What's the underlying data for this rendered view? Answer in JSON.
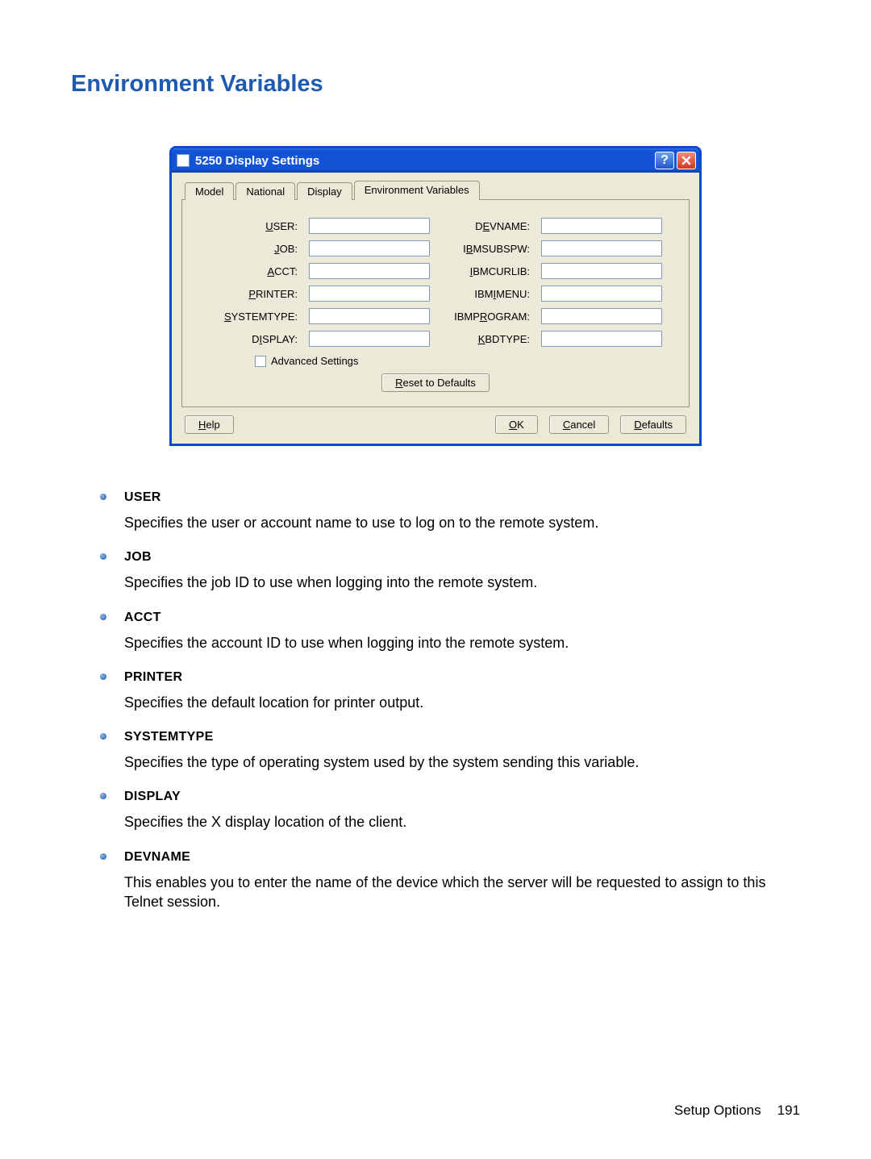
{
  "heading": "Environment Variables",
  "dialog": {
    "title": "5250 Display Settings",
    "tabs": [
      "Model",
      "National",
      "Display",
      "Environment Variables"
    ],
    "activeTab": 3,
    "fieldsLeft": [
      "USER:",
      "JOB:",
      "ACCT:",
      "PRINTER:",
      "SYSTEMTYPE:",
      "DISPLAY:"
    ],
    "fieldsRight": [
      "DEVNAME:",
      "IBMSUBSPW:",
      "IBMCURLIB:",
      "IBMIMENU:",
      "IBMPROGRAM:",
      "KBDTYPE:"
    ],
    "advanced": "Advanced Settings",
    "reset": "Reset to Defaults",
    "buttons": {
      "help": "Help",
      "ok": "OK",
      "cancel": "Cancel",
      "defaults": "Defaults"
    }
  },
  "defs": [
    {
      "term": "USER",
      "desc": "Specifies the user or account name to use to log on to the remote system."
    },
    {
      "term": "JOB",
      "desc": "Specifies the job ID to use when logging into the remote system."
    },
    {
      "term": "ACCT",
      "desc": "Specifies the account ID to use when logging into the remote system."
    },
    {
      "term": "PRINTER",
      "desc": "Specifies the default location for printer output."
    },
    {
      "term": "SYSTEMTYPE",
      "desc": "Specifies the type of operating system used by the system sending this variable."
    },
    {
      "term": "DISPLAY",
      "desc": "Specifies the X display location of the client."
    },
    {
      "term": "DEVNAME",
      "desc": "This enables you to enter the name of the device which the server will be requested to assign to this Telnet session."
    }
  ],
  "footer": {
    "section": "Setup Options",
    "page": "191"
  }
}
